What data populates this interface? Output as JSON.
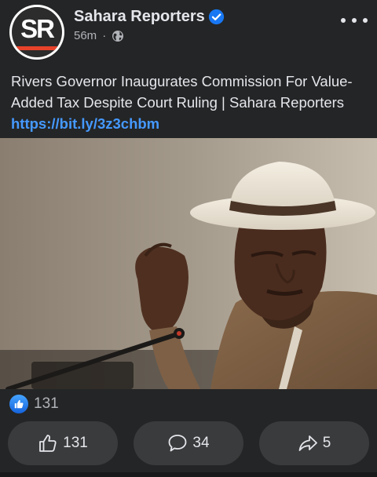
{
  "post": {
    "page_name": "Sahara Reporters",
    "avatar_text": "SR",
    "time_ago": "56m",
    "separator": "·",
    "audience_icon": "globe-icon",
    "more_icon": "more-horizontal-icon",
    "verified_icon": "verified-badge-icon",
    "text": "Rivers Governor Inaugurates Commission For Value-Added Tax Despite Court Ruling | Sahara Reporters ",
    "link": "https://bit.ly/3z3chbm",
    "image_icon": "photo"
  },
  "reactions": {
    "icon": "like-badge-icon",
    "count": "131"
  },
  "actions": {
    "like": {
      "icon": "thumbs-up-icon",
      "count": "131"
    },
    "comment": {
      "icon": "comment-bubble-icon",
      "count": "34"
    },
    "share": {
      "icon": "share-arrow-icon",
      "count": "5"
    }
  },
  "colors": {
    "background": "#242526",
    "button_bg": "#3a3b3c",
    "link": "#4599ff",
    "brand_red": "#e8422a",
    "verified_blue": "#1877f2"
  }
}
